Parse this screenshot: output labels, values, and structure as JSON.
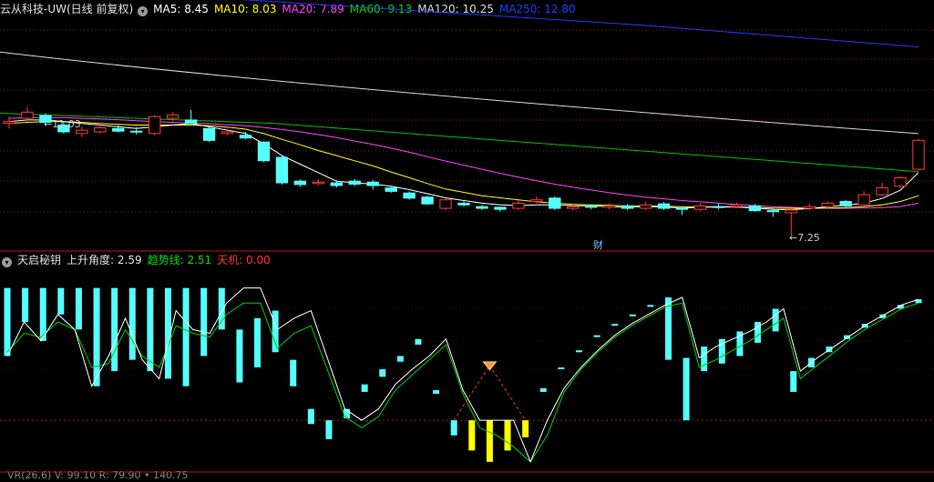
{
  "header": {
    "title": "云从科技-UW(日线 前复权)",
    "ma": [
      {
        "label": "MA5: 8.45",
        "color": "#ffffff"
      },
      {
        "label": "MA10: 8.03",
        "color": "#ffff00"
      },
      {
        "label": "MA20: 7.89",
        "color": "#ff40ff"
      },
      {
        "label": "MA60: 9.13",
        "color": "#00dd00"
      },
      {
        "label": "MA120: 10.25",
        "color": "#d8d8d8"
      },
      {
        "label": "MA250: 12.80",
        "color": "#1f3cff"
      }
    ]
  },
  "indicator_header": {
    "name": "天启秘钥",
    "angle": "上升角度: 2.59",
    "trend": "趋势线: 2.51",
    "tianji": "天机: 0.00"
  },
  "footer_partial": "VR(26,6) V: 99.10 R: 79.90 • 140.75",
  "annotations": {
    "high": "11.03",
    "low": "7.25",
    "cai": "财"
  },
  "colors": {
    "up": "#ff3a3a",
    "down": "#54ffff",
    "bg": "#000000",
    "grid": "#8a1a1a",
    "yellow": "#ffff00"
  },
  "chart_data": {
    "type": "candlestick",
    "price_range": [
      6.9,
      13.7
    ],
    "candles": [
      {
        "o": 10.55,
        "c": 10.6,
        "h": 10.75,
        "l": 10.4
      },
      {
        "o": 10.7,
        "c": 10.88,
        "h": 11.03,
        "l": 10.6
      },
      {
        "o": 10.78,
        "c": 10.58,
        "h": 10.85,
        "l": 10.5
      },
      {
        "o": 10.5,
        "c": 10.3,
        "h": 10.6,
        "l": 10.25
      },
      {
        "o": 10.25,
        "c": 10.35,
        "h": 10.45,
        "l": 10.15
      },
      {
        "o": 10.3,
        "c": 10.42,
        "h": 10.55,
        "l": 10.25
      },
      {
        "o": 10.4,
        "c": 10.32,
        "h": 10.5,
        "l": 10.28
      },
      {
        "o": 10.32,
        "c": 10.3,
        "h": 10.45,
        "l": 10.22
      },
      {
        "o": 10.25,
        "c": 10.75,
        "h": 10.8,
        "l": 10.2
      },
      {
        "o": 10.7,
        "c": 10.8,
        "h": 10.88,
        "l": 10.62
      },
      {
        "o": 10.65,
        "c": 10.55,
        "h": 10.95,
        "l": 10.5
      },
      {
        "o": 10.4,
        "c": 10.05,
        "h": 10.45,
        "l": 10.0
      },
      {
        "o": 10.25,
        "c": 10.3,
        "h": 10.4,
        "l": 10.2
      },
      {
        "o": 10.2,
        "c": 10.12,
        "h": 10.3,
        "l": 10.08
      },
      {
        "o": 10.0,
        "c": 9.45,
        "h": 10.02,
        "l": 9.4
      },
      {
        "o": 9.55,
        "c": 8.8,
        "h": 9.6,
        "l": 8.75
      },
      {
        "o": 8.85,
        "c": 8.75,
        "h": 8.9,
        "l": 8.68
      },
      {
        "o": 8.78,
        "c": 8.82,
        "h": 8.9,
        "l": 8.72
      },
      {
        "o": 8.8,
        "c": 8.72,
        "h": 8.88,
        "l": 8.66
      },
      {
        "o": 8.85,
        "c": 8.76,
        "h": 8.92,
        "l": 8.7
      },
      {
        "o": 8.82,
        "c": 8.72,
        "h": 8.88,
        "l": 8.6
      },
      {
        "o": 8.65,
        "c": 8.55,
        "h": 8.7,
        "l": 8.5
      },
      {
        "o": 8.5,
        "c": 8.35,
        "h": 8.55,
        "l": 8.3
      },
      {
        "o": 8.38,
        "c": 8.18,
        "h": 8.42,
        "l": 8.15
      },
      {
        "o": 8.05,
        "c": 8.3,
        "h": 8.35,
        "l": 8.0
      },
      {
        "o": 8.2,
        "c": 8.15,
        "h": 8.28,
        "l": 8.1
      },
      {
        "o": 8.1,
        "c": 8.05,
        "h": 8.15,
        "l": 8.0
      },
      {
        "o": 8.08,
        "c": 8.02,
        "h": 8.1,
        "l": 7.95
      },
      {
        "o": 8.05,
        "c": 8.2,
        "h": 8.28,
        "l": 8.0
      },
      {
        "o": 8.25,
        "c": 8.3,
        "h": 8.4,
        "l": 8.2
      },
      {
        "o": 8.35,
        "c": 8.05,
        "h": 8.4,
        "l": 8.0
      },
      {
        "o": 8.05,
        "c": 8.1,
        "h": 8.18,
        "l": 8.0
      },
      {
        "o": 8.12,
        "c": 8.08,
        "h": 8.16,
        "l": 8.02
      },
      {
        "o": 8.08,
        "c": 8.12,
        "h": 8.2,
        "l": 8.02
      },
      {
        "o": 8.12,
        "c": 8.05,
        "h": 8.18,
        "l": 8.0
      },
      {
        "o": 8.05,
        "c": 8.15,
        "h": 8.25,
        "l": 8.0
      },
      {
        "o": 8.18,
        "c": 8.05,
        "h": 8.24,
        "l": 8.0
      },
      {
        "o": 8.05,
        "c": 8.02,
        "h": 8.1,
        "l": 7.85
      },
      {
        "o": 8.02,
        "c": 8.12,
        "h": 8.2,
        "l": 7.98
      },
      {
        "o": 8.1,
        "c": 8.08,
        "h": 8.18,
        "l": 8.02
      },
      {
        "o": 8.1,
        "c": 8.15,
        "h": 8.22,
        "l": 8.05
      },
      {
        "o": 8.12,
        "c": 7.98,
        "h": 8.18,
        "l": 7.95
      },
      {
        "o": 7.98,
        "c": 7.95,
        "h": 8.05,
        "l": 7.8
      },
      {
        "o": 7.92,
        "c": 8.0,
        "h": 8.05,
        "l": 7.25
      },
      {
        "o": 8.05,
        "c": 8.1,
        "h": 8.18,
        "l": 8.0
      },
      {
        "o": 8.1,
        "c": 8.2,
        "h": 8.25,
        "l": 8.05
      },
      {
        "o": 8.25,
        "c": 8.12,
        "h": 8.3,
        "l": 8.08
      },
      {
        "o": 8.15,
        "c": 8.45,
        "h": 8.55,
        "l": 8.1
      },
      {
        "o": 8.45,
        "c": 8.65,
        "h": 8.8,
        "l": 8.4
      },
      {
        "o": 8.7,
        "c": 8.95,
        "h": 9.0,
        "l": 8.65
      },
      {
        "o": 9.2,
        "c": 10.05,
        "h": 10.1,
        "l": 9.15
      }
    ],
    "ma5": [
      10.6,
      10.65,
      10.65,
      10.6,
      10.55,
      10.5,
      10.45,
      10.4,
      10.45,
      10.5,
      10.55,
      10.45,
      10.35,
      10.25,
      9.95,
      9.6,
      9.35,
      9.1,
      8.85,
      8.8,
      8.76,
      8.7,
      8.6,
      8.48,
      8.36,
      8.28,
      8.2,
      8.15,
      8.13,
      8.15,
      8.15,
      8.13,
      8.12,
      8.1,
      8.09,
      8.1,
      8.09,
      8.06,
      8.08,
      8.1,
      8.09,
      8.06,
      8.02,
      8.01,
      8.04,
      8.1,
      8.14,
      8.2,
      8.34,
      8.58,
      9.1
    ],
    "ma10": [
      10.55,
      10.58,
      10.6,
      10.6,
      10.58,
      10.55,
      10.52,
      10.5,
      10.5,
      10.5,
      10.5,
      10.48,
      10.44,
      10.38,
      10.25,
      10.08,
      9.92,
      9.75,
      9.6,
      9.45,
      9.3,
      9.12,
      8.95,
      8.78,
      8.62,
      8.52,
      8.42,
      8.36,
      8.3,
      8.24,
      8.2,
      8.17,
      8.15,
      8.14,
      8.12,
      8.12,
      8.11,
      8.1,
      8.09,
      8.09,
      8.09,
      8.08,
      8.06,
      8.05,
      8.05,
      8.06,
      8.07,
      8.1,
      8.15,
      8.25,
      8.42
    ],
    "ma20": [
      10.7,
      10.72,
      10.72,
      10.72,
      10.7,
      10.68,
      10.66,
      10.63,
      10.6,
      10.58,
      10.56,
      10.54,
      10.51,
      10.48,
      10.43,
      10.37,
      10.3,
      10.22,
      10.13,
      10.03,
      9.93,
      9.82,
      9.7,
      9.57,
      9.44,
      9.32,
      9.2,
      9.08,
      8.97,
      8.86,
      8.76,
      8.67,
      8.59,
      8.51,
      8.44,
      8.38,
      8.33,
      8.28,
      8.24,
      8.2,
      8.16,
      8.13,
      8.1,
      8.08,
      8.06,
      8.05,
      8.05,
      8.06,
      8.07,
      8.1,
      8.2
    ],
    "ma60": {
      "from": 10.85,
      "to": 9.13
    },
    "ma120": {
      "from": 12.65,
      "to": 10.25
    },
    "ma250": {
      "from": 14.65,
      "to": 12.8
    },
    "indicator": {
      "range": [
        -1.7,
        3.4
      ],
      "bars": [
        {
          "t": 3.0,
          "b": 1.2,
          "c": "cyan"
        },
        {
          "t": 3.0,
          "b": 2.1,
          "c": "cyan"
        },
        {
          "t": 3.0,
          "b": 1.6,
          "c": "cyan"
        },
        {
          "t": 3.0,
          "b": 2.3,
          "c": "cyan"
        },
        {
          "t": 3.0,
          "b": 1.9,
          "c": "cyan"
        },
        {
          "t": 3.0,
          "b": 0.4,
          "c": "cyan"
        },
        {
          "t": 3.0,
          "b": 0.8,
          "c": "cyan"
        },
        {
          "t": 3.0,
          "b": 1.1,
          "c": "cyan"
        },
        {
          "t": 3.0,
          "b": 0.8,
          "c": "cyan"
        },
        {
          "t": 3.0,
          "b": 0.6,
          "c": "cyan"
        },
        {
          "t": 3.0,
          "b": 0.4,
          "c": "cyan"
        },
        {
          "t": 3.0,
          "b": 1.2,
          "c": "cyan"
        },
        {
          "t": 3.0,
          "b": 1.9,
          "c": "cyan"
        },
        {
          "t": 1.9,
          "b": 0.5,
          "c": "cyan"
        },
        {
          "t": 2.2,
          "b": 0.9,
          "c": "cyan"
        },
        {
          "t": 2.4,
          "b": 1.3,
          "c": "cyan"
        },
        {
          "t": 1.1,
          "b": 0.4,
          "c": "cyan"
        },
        {
          "t": -0.2,
          "b": -0.6,
          "c": "cyan"
        },
        {
          "t": -0.5,
          "b": -1.0,
          "c": "cyan"
        },
        {
          "t": -0.2,
          "b": -0.45,
          "c": "cyan"
        },
        {
          "t": 0.45,
          "b": 0.25,
          "c": "cyan"
        },
        {
          "t": 0.85,
          "b": 0.65,
          "c": "cyan"
        },
        {
          "t": 1.2,
          "b": 1.05,
          "c": "cyan"
        },
        {
          "t": 1.65,
          "b": 1.5,
          "c": "cyan"
        },
        {
          "t": 0.3,
          "b": 0.2,
          "c": "cyan"
        },
        {
          "t": -0.5,
          "b": -0.9,
          "c": "cyan"
        },
        {
          "t": -0.5,
          "b": -1.3,
          "c": "yellow"
        },
        {
          "t": -0.5,
          "b": -1.6,
          "c": "yellow"
        },
        {
          "t": -0.5,
          "b": -1.3,
          "c": "yellow"
        },
        {
          "t": -0.5,
          "b": -0.95,
          "c": "yellow"
        },
        {
          "t": 0.35,
          "b": 0.25,
          "c": "cyan"
        },
        {
          "t": 0.9,
          "b": 0.85,
          "c": "cyan"
        },
        {
          "t": 1.35,
          "b": 1.3,
          "c": "cyan"
        },
        {
          "t": 1.75,
          "b": 1.7,
          "c": "cyan"
        },
        {
          "t": 2.05,
          "b": 2.0,
          "c": "cyan"
        },
        {
          "t": 2.3,
          "b": 2.25,
          "c": "cyan"
        },
        {
          "t": 2.55,
          "b": 2.5,
          "c": "cyan"
        },
        {
          "t": 2.75,
          "b": 1.1,
          "c": "cyan"
        },
        {
          "t": 1.15,
          "b": -0.5,
          "c": "cyan"
        },
        {
          "t": 1.45,
          "b": 0.8,
          "c": "cyan"
        },
        {
          "t": 1.65,
          "b": 1.0,
          "c": "cyan"
        },
        {
          "t": 1.85,
          "b": 1.2,
          "c": "cyan"
        },
        {
          "t": 2.1,
          "b": 1.55,
          "c": "cyan"
        },
        {
          "t": 2.45,
          "b": 1.85,
          "c": "cyan"
        },
        {
          "t": 0.8,
          "b": 0.25,
          "c": "cyan"
        },
        {
          "t": 1.15,
          "b": 0.9,
          "c": "cyan"
        },
        {
          "t": 1.45,
          "b": 1.3,
          "c": "cyan"
        },
        {
          "t": 1.75,
          "b": 1.65,
          "c": "cyan"
        },
        {
          "t": 2.05,
          "b": 1.95,
          "c": "cyan"
        },
        {
          "t": 2.3,
          "b": 2.2,
          "c": "cyan"
        },
        {
          "t": 2.55,
          "b": 2.45,
          "c": "cyan"
        },
        {
          "t": 2.7,
          "b": 2.6,
          "c": "cyan"
        }
      ],
      "white": [
        1.2,
        2.1,
        1.6,
        2.3,
        1.9,
        0.4,
        1.2,
        2.2,
        1.1,
        0.6,
        2.4,
        1.9,
        1.8,
        2.6,
        3.0,
        3.0,
        1.9,
        2.2,
        2.4,
        1.1,
        -0.2,
        -0.5,
        -0.2,
        0.45,
        0.85,
        1.2,
        1.65,
        0.3,
        -0.5,
        -0.5,
        -0.5,
        -1.6,
        -0.5,
        0.35,
        0.9,
        1.35,
        1.75,
        2.05,
        2.3,
        2.55,
        2.75,
        1.15,
        1.45,
        1.65,
        1.85,
        2.1,
        2.45,
        0.8,
        1.15,
        1.45,
        1.75,
        2.05,
        2.3,
        2.55,
        2.7
      ],
      "green": [
        1.3,
        1.8,
        1.7,
        2.1,
        1.9,
        0.9,
        1.0,
        1.9,
        1.2,
        0.9,
        2.0,
        1.8,
        1.7,
        2.3,
        2.6,
        2.6,
        1.4,
        1.8,
        2.0,
        0.8,
        -0.4,
        -0.7,
        -0.4,
        0.3,
        0.7,
        1.1,
        1.5,
        0.2,
        -0.7,
        -0.9,
        -1.2,
        -1.6,
        -0.9,
        0.25,
        0.85,
        1.3,
        1.7,
        2.0,
        2.25,
        2.5,
        2.6,
        0.9,
        1.1,
        1.35,
        1.6,
        1.9,
        2.2,
        0.6,
        0.95,
        1.3,
        1.65,
        1.95,
        2.2,
        2.45,
        2.6
      ],
      "zero_line": -0.5
    }
  }
}
